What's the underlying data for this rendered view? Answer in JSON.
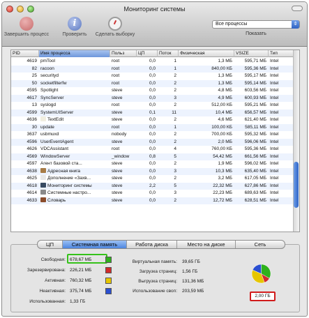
{
  "window": {
    "title": "Мониторинг системы",
    "toolbar": {
      "quit_label": "Завершить процесс",
      "inspect_label": "Проверить",
      "sample_label": "Сделать выборку"
    },
    "filter": {
      "selected": "Все процессы",
      "show_label": "Показать"
    }
  },
  "table": {
    "columns": [
      "PID",
      "Имя процесса",
      "Польз",
      "ЦП",
      "Поток",
      "Физическая",
      "VSIZE",
      "Тип"
    ],
    "sorted_column": "Имя процесса",
    "rows": [
      {
        "pid": "4619",
        "name": "pmTool",
        "user": "root",
        "cpu": "0,0",
        "threads": "1",
        "mem": "1,3 МБ",
        "vsize": "595,71 МБ",
        "type": "Intel",
        "icon": ""
      },
      {
        "pid": "82",
        "name": "racoon",
        "user": "root",
        "cpu": "0,0",
        "threads": "1",
        "mem": "840,00 КБ",
        "vsize": "595,36 МБ",
        "type": "Intel",
        "icon": ""
      },
      {
        "pid": "25",
        "name": "securityd",
        "user": "root",
        "cpu": "0,0",
        "threads": "2",
        "mem": "1,3 МБ",
        "vsize": "595,17 МБ",
        "type": "Intel",
        "icon": ""
      },
      {
        "pid": "50",
        "name": "socketfilterfw",
        "user": "root",
        "cpu": "0,0",
        "threads": "2",
        "mem": "1,3 МБ",
        "vsize": "595,14 МБ",
        "type": "Intel",
        "icon": ""
      },
      {
        "pid": "4595",
        "name": "Spotlight",
        "user": "steve",
        "cpu": "0,0",
        "threads": "2",
        "mem": "4,8 МБ",
        "vsize": "603,56 МБ",
        "type": "Intel",
        "icon": ""
      },
      {
        "pid": "4617",
        "name": "SyncServer",
        "user": "steve",
        "cpu": "0,0",
        "threads": "3",
        "mem": "4,9 МБ",
        "vsize": "600,93 МБ",
        "type": "Intel",
        "icon": ""
      },
      {
        "pid": "13",
        "name": "syslogd",
        "user": "root",
        "cpu": "0,0",
        "threads": "2",
        "mem": "512,00 КБ",
        "vsize": "595,21 МБ",
        "type": "Intel",
        "icon": ""
      },
      {
        "pid": "4599",
        "name": "SystemUIServer",
        "user": "steve",
        "cpu": "0,1",
        "threads": "11",
        "mem": "10,4 МБ",
        "vsize": "656,57 МБ",
        "type": "Intel",
        "icon": ""
      },
      {
        "pid": "4636",
        "name": "TextEdit",
        "user": "steve",
        "cpu": "0,0",
        "threads": "2",
        "mem": "4,6 МБ",
        "vsize": "621,40 МБ",
        "type": "Intel",
        "icon": "#f1eee0"
      },
      {
        "pid": "30",
        "name": "update",
        "user": "root",
        "cpu": "0,0",
        "threads": "1",
        "mem": "100,00 КБ",
        "vsize": "585,11 МБ",
        "type": "Intel",
        "icon": ""
      },
      {
        "pid": "3637",
        "name": "usbmuxd",
        "user": "nobody",
        "cpu": "0,0",
        "threads": "2",
        "mem": "700,00 КБ",
        "vsize": "595,32 МБ",
        "type": "Intel",
        "icon": ""
      },
      {
        "pid": "4596",
        "name": "UserEventAgent",
        "user": "steve",
        "cpu": "0,0",
        "threads": "2",
        "mem": "2,0 МБ",
        "vsize": "596,06 МБ",
        "type": "Intel",
        "icon": ""
      },
      {
        "pid": "4626",
        "name": "VDCAssistant",
        "user": "root",
        "cpu": "0,0",
        "threads": "4",
        "mem": "760,00 КБ",
        "vsize": "595,36 МБ",
        "type": "Intel",
        "icon": ""
      },
      {
        "pid": "4569",
        "name": "WindowServer",
        "user": "_window",
        "cpu": "0,8",
        "threads": "5",
        "mem": "54,42 МБ",
        "vsize": "661,56 МБ",
        "type": "Intel",
        "icon": ""
      },
      {
        "pid": "4597",
        "name": "Агент базовой ста...",
        "user": "steve",
        "cpu": "0,0",
        "threads": "2",
        "mem": "1,9 МБ",
        "vsize": "596,02 МБ",
        "type": "Intel",
        "icon": ""
      },
      {
        "pid": "4638",
        "name": "Адресная книга",
        "user": "steve",
        "cpu": "0,0",
        "threads": "3",
        "mem": "10,3 МБ",
        "vsize": "635,40 МБ",
        "type": "Intel",
        "icon": "#a77b46"
      },
      {
        "pid": "4625",
        "name": "Дополнение «Захв...",
        "user": "steve",
        "cpu": "0,0",
        "threads": "2",
        "mem": "3,2 МБ",
        "vsize": "617,05 МБ",
        "type": "Intel",
        "icon": "#e7e7e7"
      },
      {
        "pid": "4618",
        "name": "Мониторинг системы",
        "user": "steve",
        "cpu": "2,2",
        "threads": "5",
        "mem": "22,32 МБ",
        "vsize": "627,86 МБ",
        "type": "Intel",
        "icon": "#384b62"
      },
      {
        "pid": "4614",
        "name": "Системные настро...",
        "user": "steve",
        "cpu": "0,0",
        "threads": "3",
        "mem": "22,23 МБ",
        "vsize": "689,63 МБ",
        "type": "Intel",
        "icon": "#8a8a8a"
      },
      {
        "pid": "4633",
        "name": "Словарь",
        "user": "steve",
        "cpu": "0,0",
        "threads": "2",
        "mem": "12,72 МБ",
        "vsize": "628,51 МБ",
        "type": "Intel",
        "icon": "#8b4d2c"
      }
    ]
  },
  "tabs": [
    "ЦП",
    "Системная память",
    "Работа диска",
    "Место на диске",
    "Сеть"
  ],
  "active_tab": "Системная память",
  "memory": {
    "free_label": "Свободная:",
    "free_value": "678,67 МБ",
    "free_color": "#2fb11c",
    "wired_label": "Зарезервирована:",
    "wired_value": "226,21 МБ",
    "wired_color": "#d22b2b",
    "active_label": "Активная:",
    "active_value": "760,32 МБ",
    "active_color": "#e6c600",
    "inactive_label": "Неактивная:",
    "inactive_value": "375,74 МБ",
    "inactive_color": "#2a4fd1",
    "used_label": "Использованная:",
    "used_value": "1,33 ГБ",
    "vm_label": "Виртуальная память:",
    "vm_value": "39,65 ГБ",
    "pageins_label": "Загрузка страниц:",
    "pageins_value": "1,56 ГБ",
    "pageouts_label": "Выгрузка страниц:",
    "pageouts_value": "131,36 МБ",
    "swap_label": "Использование своп:",
    "swap_value": "203,59 МБ",
    "total_value": "2,00 ГБ"
  }
}
